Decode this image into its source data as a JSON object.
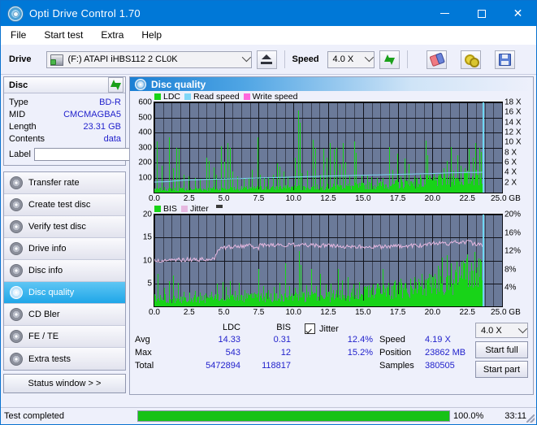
{
  "window": {
    "title": "Opti Drive Control 1.70",
    "icon": "disc-icon",
    "minimize": "—",
    "maximize": "□",
    "close": "✕"
  },
  "menu": [
    "File",
    "Start test",
    "Extra",
    "Help"
  ],
  "toolbar": {
    "drive_label": "Drive",
    "drive_value": "(F:)  ATAPI iHBS112  2 CL0K",
    "eject_title": "Eject",
    "speed_label": "Speed",
    "speed_value": "4.0 X",
    "refresh_title": "Refresh",
    "erase_title": "Erase",
    "settings_title": "Settings",
    "save_title": "Save"
  },
  "disc_panel": {
    "title": "Disc",
    "refresh_icon": "refresh-icon",
    "rows": [
      {
        "key": "Type",
        "value": "BD-R"
      },
      {
        "key": "MID",
        "value": "CMCMAGBA5"
      },
      {
        "key": "Length",
        "value": "23.31 GB"
      },
      {
        "key": "Contents",
        "value": "data"
      }
    ],
    "label_key": "Label",
    "label_value": "",
    "label_placeholder": ""
  },
  "nav": {
    "items": [
      {
        "label": "Transfer rate",
        "selected": false
      },
      {
        "label": "Create test disc",
        "selected": false
      },
      {
        "label": "Verify test disc",
        "selected": false
      },
      {
        "label": "Drive info",
        "selected": false
      },
      {
        "label": "Disc info",
        "selected": false
      },
      {
        "label": "Disc quality",
        "selected": true
      },
      {
        "label": "CD Bler",
        "selected": false
      },
      {
        "label": "FE / TE",
        "selected": false
      },
      {
        "label": "Extra tests",
        "selected": false
      }
    ],
    "status_window": "Status window > >"
  },
  "content": {
    "title": "Disc quality"
  },
  "stats": {
    "col_ldc": "LDC",
    "col_bis": "BIS",
    "jitter_label": "Jitter",
    "jitter_checked": true,
    "rows": [
      {
        "label": "Avg",
        "ldc": "14.33",
        "bis": "0.31",
        "jitter": "12.4%"
      },
      {
        "label": "Max",
        "ldc": "543",
        "bis": "12",
        "jitter": "15.2%"
      },
      {
        "label": "Total",
        "ldc": "5472894",
        "bis": "118817",
        "jitter": ""
      }
    ],
    "speed_label": "Speed",
    "speed_value": "4.19 X",
    "position_label": "Position",
    "position_value": "23862 MB",
    "samples_label": "Samples",
    "samples_value": "380505",
    "speed_select": "4.0 X",
    "start_full": "Start full",
    "start_part": "Start part"
  },
  "statusbar": {
    "text": "Test completed",
    "progress_pct": "100.0%",
    "progress_value": 100,
    "elapsed": "33:11"
  },
  "colors": {
    "accent": "#0078d7",
    "ldc_green": "#18d318",
    "read_speed": "#7fd6f7",
    "write_speed": "#ff66dd",
    "jitter_pink": "#e6b8e0",
    "plot_bg": "#6b7a99",
    "value_blue": "#2222cc",
    "progress_green": "#17c217"
  },
  "chart_data": [
    {
      "type": "bar",
      "name": "ldc-chart",
      "title": "",
      "xlabel": "GB",
      "ylabel": "",
      "xlim": [
        0,
        25
      ],
      "ylim": [
        0,
        600
      ],
      "y2lim": [
        0,
        18
      ],
      "y2label": "X",
      "grid": true,
      "legend_position": "top-left",
      "legend": [
        {
          "label": "LDC",
          "color": "#18d318"
        },
        {
          "label": "Read speed",
          "color": "#7fd6f7"
        },
        {
          "label": "Write speed",
          "color": "#ff66dd"
        }
      ],
      "xticks": [
        "0.0",
        "2.5",
        "5.0",
        "7.5",
        "10.0",
        "12.5",
        "15.0",
        "17.5",
        "20.0",
        "22.5",
        "25.0 GB"
      ],
      "yticks": [
        "100",
        "200",
        "300",
        "400",
        "500",
        "600"
      ],
      "y2ticks": [
        "2 X",
        "4 X",
        "6 X",
        "8 X",
        "10 X",
        "12 X",
        "14 X",
        "16 X",
        "18 X"
      ],
      "cursor_x": 23.6,
      "series": [
        {
          "name": "LDC",
          "color": "#18d318",
          "note": "per-sample LDC error counts, baseline rising from ~20 to ~90 across disc with frequent spikes",
          "baseline_x": [
            0,
            2,
            4,
            6,
            8,
            10,
            12,
            14,
            16,
            18,
            20,
            21,
            22,
            23,
            23.6
          ],
          "baseline_y": [
            22,
            20,
            22,
            25,
            28,
            30,
            33,
            38,
            45,
            55,
            70,
            78,
            85,
            92,
            95
          ],
          "spikes": [
            [
              0.15,
              340
            ],
            [
              0.55,
              180
            ],
            [
              1.05,
              370
            ],
            [
              1.35,
              160
            ],
            [
              1.6,
              300
            ],
            [
              1.75,
              290
            ],
            [
              2.1,
              120
            ],
            [
              2.45,
              110
            ],
            [
              2.9,
              95
            ],
            [
              3.3,
              90
            ],
            [
              3.75,
              230
            ],
            [
              3.9,
              210
            ],
            [
              4.25,
              165
            ],
            [
              4.45,
              120
            ],
            [
              4.8,
              310
            ],
            [
              5.0,
              205
            ],
            [
              5.25,
              330
            ],
            [
              5.45,
              300
            ],
            [
              5.6,
              140
            ],
            [
              5.95,
              110
            ],
            [
              6.4,
              90
            ],
            [
              6.8,
              100
            ],
            [
              7.0,
              150
            ],
            [
              7.4,
              365
            ],
            [
              7.6,
              120
            ],
            [
              7.9,
              95
            ],
            [
              8.2,
              105
            ],
            [
              8.5,
              120
            ],
            [
              8.8,
              195
            ],
            [
              9.0,
              175
            ],
            [
              9.3,
              140
            ],
            [
              9.6,
              110
            ],
            [
              10.1,
              230
            ],
            [
              10.35,
              545
            ],
            [
              10.45,
              465
            ],
            [
              10.6,
              130
            ],
            [
              11.0,
              145
            ],
            [
              11.4,
              350
            ],
            [
              11.55,
              300
            ],
            [
              11.9,
              120
            ],
            [
              12.15,
              290
            ],
            [
              12.4,
              230
            ],
            [
              12.6,
              330
            ],
            [
              12.9,
              285
            ],
            [
              13.1,
              300
            ],
            [
              13.3,
              190
            ],
            [
              13.55,
              330
            ],
            [
              13.7,
              200
            ],
            [
              14.0,
              120
            ],
            [
              14.35,
              340
            ],
            [
              14.5,
              265
            ],
            [
              14.9,
              115
            ],
            [
              15.3,
              120
            ],
            [
              15.6,
              105
            ],
            [
              16.0,
              95
            ],
            [
              16.4,
              100
            ],
            [
              16.9,
              305
            ],
            [
              17.1,
              150
            ],
            [
              17.45,
              260
            ],
            [
              17.7,
              110
            ],
            [
              18.0,
              225
            ],
            [
              18.3,
              190
            ],
            [
              18.7,
              110
            ],
            [
              19.1,
              120
            ],
            [
              19.5,
              345
            ],
            [
              19.65,
              250
            ],
            [
              20.1,
              130
            ],
            [
              20.4,
              110
            ],
            [
              20.8,
              160
            ],
            [
              21.0,
              210
            ],
            [
              21.3,
              305
            ],
            [
              21.5,
              145
            ],
            [
              21.8,
              250
            ],
            [
              22.0,
              180
            ],
            [
              22.3,
              160
            ],
            [
              22.6,
              290
            ],
            [
              22.9,
              230
            ],
            [
              23.1,
              330
            ],
            [
              23.35,
              300
            ],
            [
              23.5,
              270
            ]
          ]
        },
        {
          "name": "Read speed",
          "color": "#7fd6f7",
          "note": "stepped read speed curve, 2x axis units, rising ~2.1X to ~4.1X",
          "x": [
            0,
            1.0,
            2.2,
            3.4,
            4.6,
            6.0,
            7.3,
            8.6,
            10.0,
            11.2,
            12.5,
            14.0,
            15.5,
            17.0,
            18.5,
            20.0,
            21.3,
            22.5,
            23.6
          ],
          "y_x": [
            2.1,
            2.2,
            2.5,
            2.6,
            2.7,
            2.8,
            2.9,
            3.0,
            3.1,
            3.2,
            3.3,
            3.4,
            3.5,
            3.6,
            3.7,
            3.8,
            3.95,
            4.0,
            4.05
          ]
        }
      ]
    },
    {
      "type": "bar",
      "name": "bis-jitter-chart",
      "title": "",
      "xlabel": "GB",
      "ylabel": "",
      "xlim": [
        0,
        25
      ],
      "ylim": [
        0,
        20
      ],
      "y2lim": [
        0,
        20
      ],
      "y2label": "%",
      "grid": true,
      "legend_position": "top-left",
      "legend": [
        {
          "label": "BIS",
          "color": "#18d318"
        },
        {
          "label": "Jitter",
          "color": "#e6b8e0"
        }
      ],
      "xticks": [
        "0.0",
        "2.5",
        "5.0",
        "7.5",
        "10.0",
        "12.5",
        "15.0",
        "17.5",
        "20.0",
        "22.5",
        "25.0 GB"
      ],
      "yticks": [
        "5",
        "10",
        "15",
        "20"
      ],
      "y2ticks": [
        "4%",
        "8%",
        "12%",
        "16%",
        "20%"
      ],
      "cursor_x": 23.6,
      "series": [
        {
          "name": "BIS",
          "color": "#18d318",
          "note": "baseline ~1.5-2 rising to ~6-7 near end, dense spikes to 5-12",
          "baseline_x": [
            0,
            3,
            6,
            9,
            12,
            14,
            16,
            18,
            20,
            21,
            22,
            23,
            23.6
          ],
          "baseline_y": [
            1.6,
            1.5,
            1.7,
            1.8,
            2.0,
            2.4,
            3.0,
            3.6,
            4.6,
            5.4,
            6.0,
            6.4,
            6.6
          ],
          "spikes": [
            [
              0.25,
              7.0
            ],
            [
              0.7,
              4.0
            ],
            [
              1.05,
              5.5
            ],
            [
              1.35,
              6.8
            ],
            [
              1.7,
              5.2
            ],
            [
              2.1,
              3.2
            ],
            [
              2.5,
              3.0
            ],
            [
              2.9,
              3.4
            ],
            [
              3.3,
              3.0
            ],
            [
              3.7,
              2.8
            ],
            [
              4.1,
              3.2
            ],
            [
              4.5,
              5.0
            ],
            [
              4.9,
              5.4
            ],
            [
              5.15,
              4.2
            ],
            [
              5.45,
              5.5
            ],
            [
              5.8,
              3.4
            ],
            [
              6.1,
              5.2
            ],
            [
              6.5,
              3.6
            ],
            [
              6.9,
              2.6
            ],
            [
              7.2,
              3.0
            ],
            [
              7.5,
              8.1
            ],
            [
              7.8,
              4.4
            ],
            [
              8.2,
              3.6
            ],
            [
              8.6,
              4.2
            ],
            [
              9.0,
              5.2
            ],
            [
              9.4,
              9.3
            ],
            [
              9.7,
              4.4
            ],
            [
              10.1,
              4.0
            ],
            [
              10.4,
              12.1
            ],
            [
              10.5,
              9.0
            ],
            [
              10.9,
              4.6
            ],
            [
              11.3,
              8.1
            ],
            [
              11.6,
              4.4
            ],
            [
              11.9,
              7.0
            ],
            [
              12.3,
              4.8
            ],
            [
              12.7,
              5.0
            ],
            [
              13.2,
              8.2
            ],
            [
              13.5,
              5.6
            ],
            [
              13.9,
              6.4
            ],
            [
              14.3,
              4.8
            ],
            [
              14.7,
              5.4
            ],
            [
              15.1,
              4.4
            ],
            [
              15.6,
              4.0
            ],
            [
              16.0,
              5.0
            ],
            [
              16.4,
              8.1
            ],
            [
              16.8,
              5.2
            ],
            [
              17.2,
              4.6
            ],
            [
              17.6,
              5.4
            ],
            [
              18.0,
              5.0
            ],
            [
              18.4,
              6.0
            ],
            [
              18.8,
              5.4
            ],
            [
              19.2,
              7.0
            ],
            [
              19.6,
              5.6
            ],
            [
              20.0,
              6.4
            ],
            [
              20.4,
              8.8
            ],
            [
              20.7,
              10.6
            ],
            [
              21.0,
              11.2
            ],
            [
              21.3,
              9.4
            ],
            [
              21.6,
              8.0
            ],
            [
              21.9,
              8.6
            ],
            [
              22.2,
              10.0
            ],
            [
              22.5,
              11.4
            ],
            [
              22.8,
              9.6
            ],
            [
              23.0,
              11.8
            ],
            [
              23.3,
              10.4
            ],
            [
              23.5,
              9.0
            ]
          ]
        },
        {
          "name": "Jitter",
          "color": "#e6b8e0",
          "note": "percent jitter: ~10% for first 4.5GB, step up to ~13%, holds 12-14% to end",
          "x": [
            0,
            0.5,
            1.5,
            2.5,
            3.5,
            4.3,
            4.6,
            5.0,
            5.5,
            6.0,
            7.0,
            7.4,
            7.6,
            8.5,
            9.5,
            10.5,
            11.5,
            12.5,
            13.5,
            14.5,
            15.5,
            16.5,
            17.5,
            18.5,
            19.5,
            20.5,
            21.0,
            21.5,
            22.0,
            22.5,
            23.0,
            23.6
          ],
          "y": [
            9.9,
            10.0,
            10.1,
            10.2,
            10.2,
            10.4,
            12.2,
            12.8,
            13.0,
            13.1,
            13.2,
            12.4,
            13.3,
            13.4,
            13.3,
            13.4,
            13.3,
            13.2,
            13.0,
            13.1,
            12.9,
            13.0,
            13.1,
            13.2,
            13.3,
            13.9,
            13.5,
            14.0,
            13.6,
            14.2,
            13.6,
            13.4
          ]
        }
      ]
    }
  ]
}
